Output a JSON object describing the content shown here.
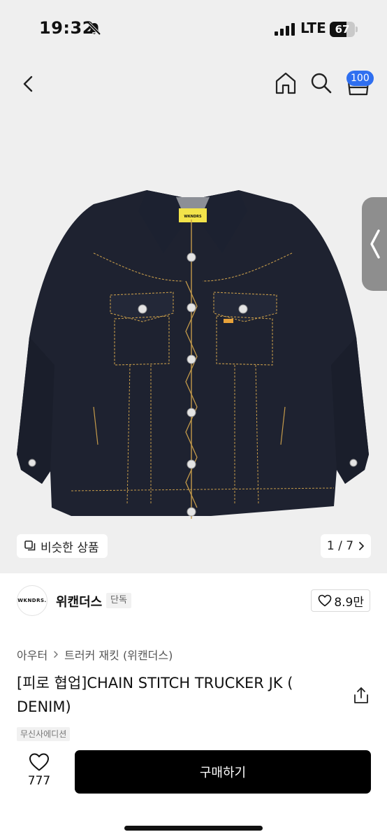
{
  "status_bar": {
    "time": "19:32",
    "network": "LTE",
    "battery_level": "67",
    "battery_fraction": 0.67,
    "icons": [
      "bell-slash-icon",
      "signal-icon",
      "battery-icon"
    ]
  },
  "nav": {
    "icons": [
      "chevron-left-icon",
      "home-icon",
      "search-icon",
      "cart-icon"
    ],
    "cart_count": "100",
    "badge_color": "#2f6ff0"
  },
  "gallery": {
    "logo_text": "WKNDRS",
    "similar_label": "비슷한 상품",
    "page_indicator": "1 / 7"
  },
  "brand": {
    "logo_text": "WKNDRS.",
    "name": "위캔더스",
    "tag": "단독",
    "likes": "8.9만"
  },
  "product": {
    "breadcrumb": [
      "아우터",
      "트러커 재킷 (위캔더스)"
    ],
    "title": "[피로 협업]CHAIN STITCH TRUCKER JK ( DENIM)",
    "edition_badge": "무신사에디션"
  },
  "bottom_bar": {
    "wish_count": "777",
    "buy_label": "구매하기",
    "buy_color": "#000000"
  }
}
